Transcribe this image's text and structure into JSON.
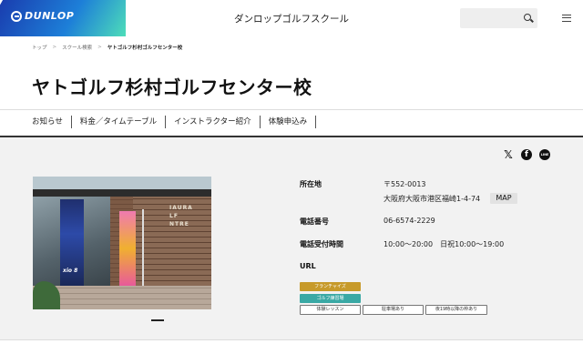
{
  "header": {
    "logo_text": "DUNLOP",
    "site_title": "ダンロップゴルフスクール",
    "search_placeholder": ""
  },
  "breadcrumb": {
    "items": [
      "トップ",
      "スクール検索",
      "ヤトゴルフ杉村ゴルフセンター校"
    ],
    "separator": ">"
  },
  "page_title": "ヤトゴルフ杉村ゴルフセンター校",
  "tabs": [
    "お知らせ",
    "料金／タイムテーブル",
    "インストラクター紹介",
    "体験申込み"
  ],
  "share": {
    "x_glyph": "𝕏",
    "facebook_glyph": "f",
    "line_glyph": "LINE"
  },
  "photo": {
    "sign_lines": [
      "IAURA",
      "LF",
      "NTRE"
    ],
    "banner_text": "xio 8"
  },
  "info": {
    "address_label": "所在地",
    "postal_code": "〒552-0013",
    "address": "大阪府大阪市港区福崎1-4-74",
    "map_button": "MAP",
    "phone_label": "電話番号",
    "phone": "06-6574-2229",
    "hours_label": "電話受付時間",
    "hours": "10:00〜20:00　日祝10:00〜19:00",
    "url_label": "URL",
    "url": ""
  },
  "badges": [
    "フランチャイズ",
    "ゴルフ練習場"
  ],
  "tags": [
    "体験レッスン",
    "駐車場あり",
    "夜19時以降の枠あり"
  ],
  "colors": {
    "brand_gradient_start": "#1a3fb0",
    "brand_gradient_end": "#4fe0b8",
    "franchise_badge": "#c79a2a",
    "range_badge": "#3aa9a5"
  }
}
